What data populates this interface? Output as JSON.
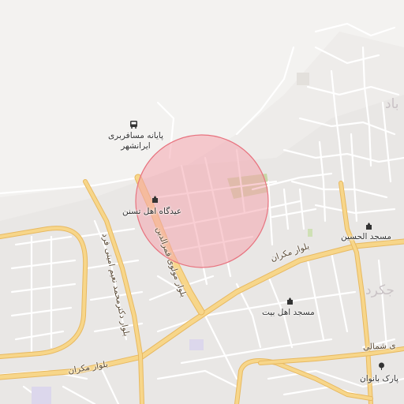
{
  "map": {
    "circle_color": "#f4a6ae",
    "road_major_color": "#f7d68a",
    "road_major_edge": "#e8b960",
    "street_color": "#ffffff",
    "background_color": "#eeecea",
    "park_color": "#c8d6a6"
  },
  "labels": {
    "bus_terminal_line1": "پایانه مسافربری",
    "bus_terminal_line2": "ایرانشهر",
    "eidgah": "عیدگاه اهل تسنن",
    "masjid_hussain": "مسجد الحسین",
    "masjid_ahlebeit": "مسجد اهل بیت",
    "park_banovan": "پارک بانوان",
    "blvd_mokran_top": "بلوار مکران",
    "blvd_mokran_bottom": "بلوار مکران",
    "blvd_ghamaruddin": "بلوار مولوی قمرالدین",
    "blvd_naeimi": "بلوار دکترمحمد نعیم امینی فرد",
    "blvd_shomali": "ی شمالی",
    "district_top": "باد",
    "district_right": "جکرد"
  },
  "icons": {
    "bus": "bus-icon",
    "mosque": "mosque-icon",
    "park": "tree-icon"
  }
}
